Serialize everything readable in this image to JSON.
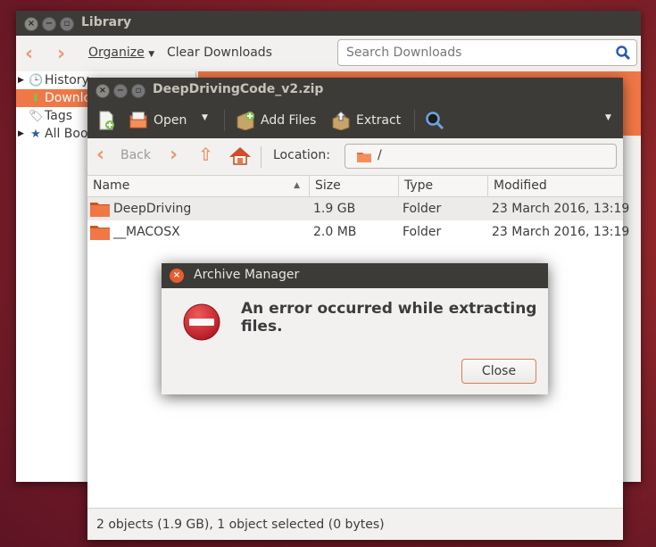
{
  "library": {
    "title": "Library",
    "toolbar": {
      "organize_label": "Organize",
      "clear_downloads_label": "Clear Downloads",
      "search_placeholder": "Search Downloads"
    },
    "sidebar": {
      "items": [
        {
          "label": "History",
          "icon": "clock-icon"
        },
        {
          "label": "Downlo",
          "icon": "download-arrow-icon"
        },
        {
          "label": "Tags",
          "icon": "tag-icon"
        },
        {
          "label": "All Boo",
          "icon": "bookmarks-star-icon"
        }
      ]
    }
  },
  "archive": {
    "title": "DeepDrivingCode_v2.zip",
    "toolbar": {
      "open_label": "Open",
      "add_files_label": "Add Files",
      "extract_label": "Extract"
    },
    "nav": {
      "back_label": "Back",
      "location_label": "Location:",
      "location_value": "/"
    },
    "columns": [
      "Name",
      "Size",
      "Type",
      "Modified"
    ],
    "rows": [
      {
        "name": "DeepDriving",
        "size": "1.9 GB",
        "type": "Folder",
        "modified": "23 March 2016, 13:19"
      },
      {
        "name": "__MACOSX",
        "size": "2.0 MB",
        "type": "Folder",
        "modified": "23 March 2016, 13:19"
      }
    ],
    "status": "2 objects (1.9 GB), 1 object selected (0 bytes)"
  },
  "dialog": {
    "title": "Archive Manager",
    "message": "An error occurred while extracting files.",
    "close_label": "Close"
  },
  "colors": {
    "accent": "#f07746",
    "titlebar": "#3c3b37",
    "error_red": "#c8202a"
  }
}
